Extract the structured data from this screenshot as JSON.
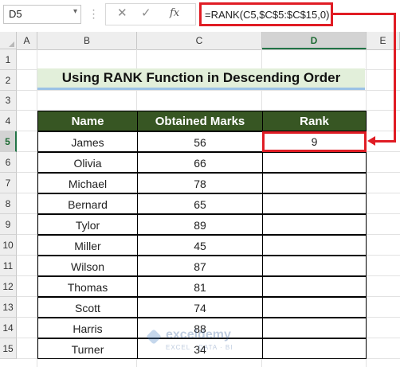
{
  "formula_bar": {
    "name_box": "D5",
    "formula": "=RANK(C5,$C$5:$C$15,0)",
    "cancel_symbol": "✕",
    "confirm_symbol": "✓",
    "fx_label": "fx"
  },
  "columns": [
    "A",
    "B",
    "C",
    "D",
    "E"
  ],
  "rows": [
    "1",
    "2",
    "3",
    "4",
    "5",
    "6",
    "7",
    "8",
    "9",
    "10",
    "11",
    "12",
    "13",
    "14",
    "15"
  ],
  "title": "Using RANK Function in Descending Order",
  "table": {
    "headers": [
      "Name",
      "Obtained Marks",
      "Rank"
    ],
    "rows": [
      {
        "name": "James",
        "marks": "56",
        "rank": "9"
      },
      {
        "name": "Olivia",
        "marks": "66",
        "rank": ""
      },
      {
        "name": "Michael",
        "marks": "78",
        "rank": ""
      },
      {
        "name": "Bernard",
        "marks": "65",
        "rank": ""
      },
      {
        "name": "Tylor",
        "marks": "89",
        "rank": ""
      },
      {
        "name": "Miller",
        "marks": "45",
        "rank": ""
      },
      {
        "name": "Wilson",
        "marks": "87",
        "rank": ""
      },
      {
        "name": "Thomas",
        "marks": "81",
        "rank": ""
      },
      {
        "name": "Scott",
        "marks": "74",
        "rank": ""
      },
      {
        "name": "Harris",
        "marks": "88",
        "rank": ""
      },
      {
        "name": "Turner",
        "marks": "34",
        "rank": ""
      }
    ]
  },
  "watermark": {
    "name": "exceldemy",
    "tagline": "EXCEL · DATA · BI"
  },
  "colors": {
    "header_green": "#375623",
    "title_fill": "#e2efda",
    "highlight_red": "#e01c24"
  }
}
